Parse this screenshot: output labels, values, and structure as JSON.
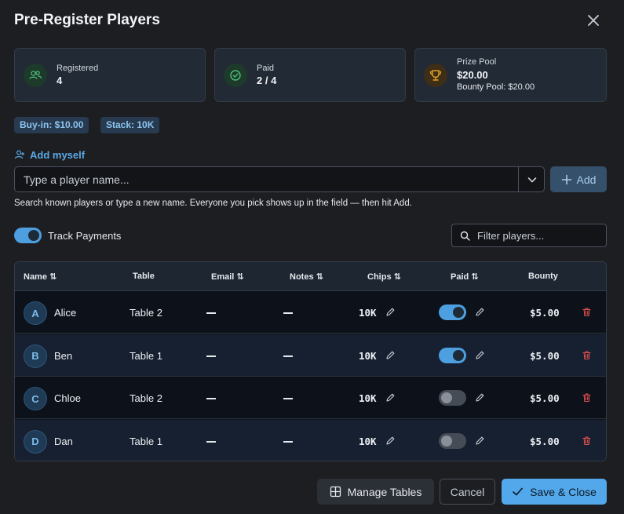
{
  "dialog": {
    "title": "Pre-Register Players"
  },
  "stats": {
    "registered": {
      "label": "Registered",
      "value": "4",
      "icon": "users-icon"
    },
    "paid": {
      "label": "Paid",
      "value": "2 / 4",
      "icon": "check-circle-icon"
    },
    "prize_pool": {
      "label": "Prize Pool",
      "value": "$20.00",
      "sub": "Bounty Pool: $20.00",
      "icon": "trophy-icon"
    }
  },
  "badges": {
    "buyin": "Buy-in: $10.00",
    "stack": "Stack: 10K"
  },
  "add_myself": "Add myself",
  "player_search": {
    "placeholder": "Type a player name...",
    "value": ""
  },
  "add_button": "Add",
  "help_text": "Search known players or type a new name. Everyone you pick shows up in the field — then hit Add.",
  "track_payments": {
    "label": "Track Payments",
    "enabled": true
  },
  "filter": {
    "placeholder": "Filter players...",
    "value": ""
  },
  "table": {
    "headers": {
      "name": "Name",
      "table": "Table",
      "email": "Email",
      "notes": "Notes",
      "chips": "Chips",
      "paid": "Paid",
      "bounty": "Bounty"
    },
    "rows": [
      {
        "initial": "A",
        "name": "Alice",
        "table": "Table 2",
        "email": "—",
        "notes": "—",
        "chips": "10K",
        "paid": true,
        "bounty": "$5.00"
      },
      {
        "initial": "B",
        "name": "Ben",
        "table": "Table 1",
        "email": "—",
        "notes": "—",
        "chips": "10K",
        "paid": true,
        "bounty": "$5.00"
      },
      {
        "initial": "C",
        "name": "Chloe",
        "table": "Table 2",
        "email": "—",
        "notes": "—",
        "chips": "10K",
        "paid": false,
        "bounty": "$5.00"
      },
      {
        "initial": "D",
        "name": "Dan",
        "table": "Table 1",
        "email": "—",
        "notes": "—",
        "chips": "10K",
        "paid": false,
        "bounty": "$5.00"
      }
    ]
  },
  "footer": {
    "manage_tables": "Manage Tables",
    "cancel": "Cancel",
    "save_close": "Save & Close"
  },
  "colors": {
    "accent": "#52a8ea",
    "danger": "#e05050",
    "success": "#3aa864",
    "gold": "#e0a020"
  }
}
